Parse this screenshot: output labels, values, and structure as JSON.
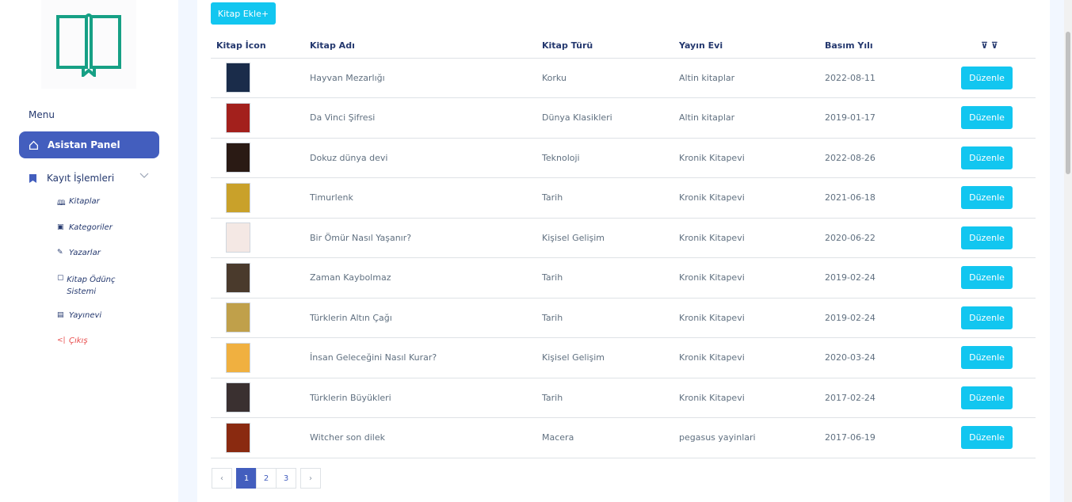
{
  "sidebar": {
    "menu_title": "Menu",
    "active_item": "Asistan Panel",
    "group_label": "Kayıt İşlemleri",
    "sub_items": [
      {
        "label": "Kitaplar",
        "icon": "book-open-icon"
      },
      {
        "label": "Kategoriler",
        "icon": "bookmark-icon"
      },
      {
        "label": "Yazarlar",
        "icon": "pen-icon"
      },
      {
        "label": "Kitap Ödünç Sistemi",
        "icon": "clipboard-icon"
      },
      {
        "label": "Yayınevi",
        "icon": "archive-icon"
      },
      {
        "label": "Çıkış",
        "icon": "logout-icon"
      }
    ]
  },
  "toolbar": {
    "add_label": "Kitap Ekle+"
  },
  "table": {
    "headers": [
      "Kitap İcon",
      "Kitap Adı",
      "Kitap Türü",
      "Yayın Evi",
      "Basım Yılı",
      "⊽ ⊽"
    ],
    "edit_label": "Düzenle",
    "rows": [
      {
        "name": "Hayvan Mezarlığı",
        "type": "Korku",
        "publisher": "Altin kitaplar",
        "year": "2022-08-11",
        "cover": "#1a2c4a"
      },
      {
        "name": "Da Vinci Şifresi",
        "type": "Dünya Klasikleri",
        "publisher": "Altin kitaplar",
        "year": "2019-01-17",
        "cover": "#a3201c"
      },
      {
        "name": "Dokuz dünya devi",
        "type": "Teknoloji",
        "publisher": "Kronik Kitapevi",
        "year": "2022-08-26",
        "cover": "#2a1a14"
      },
      {
        "name": "Timurlenk",
        "type": "Tarih",
        "publisher": "Kronik Kitapevi",
        "year": "2021-06-18",
        "cover": "#c9a12a"
      },
      {
        "name": "Bir Ömür Nasıl Yaşanır?",
        "type": "Kişisel Gelişim",
        "publisher": "Kronik Kitapevi",
        "year": "2020-06-22",
        "cover": "#f4e8e4"
      },
      {
        "name": "Zaman Kaybolmaz",
        "type": "Tarih",
        "publisher": "Kronik Kitapevi",
        "year": "2019-02-24",
        "cover": "#4a3a2c"
      },
      {
        "name": "Türklerin Altın Çağı",
        "type": "Tarih",
        "publisher": "Kronik Kitapevi",
        "year": "2019-02-24",
        "cover": "#c0a04a"
      },
      {
        "name": "İnsan Geleceğini Nasıl Kurar?",
        "type": "Kişisel Gelişim",
        "publisher": "Kronik Kitapevi",
        "year": "2020-03-24",
        "cover": "#f0b040"
      },
      {
        "name": "Türklerin Büyükleri",
        "type": "Tarih",
        "publisher": "Kronik Kitapevi",
        "year": "2017-02-24",
        "cover": "#3a3030"
      },
      {
        "name": "Witcher son dilek",
        "type": "Macera",
        "publisher": "pegasus yayinlari",
        "year": "2017-06-19",
        "cover": "#8a2a10"
      }
    ]
  },
  "pagination": {
    "prev": "‹",
    "pages": [
      "1",
      "2",
      "3"
    ],
    "current": "1",
    "next": "›"
  },
  "colors": {
    "primary": "#435ebe",
    "info": "#12c6f0",
    "logo": "#16a085",
    "exit": "#e84a4a"
  }
}
